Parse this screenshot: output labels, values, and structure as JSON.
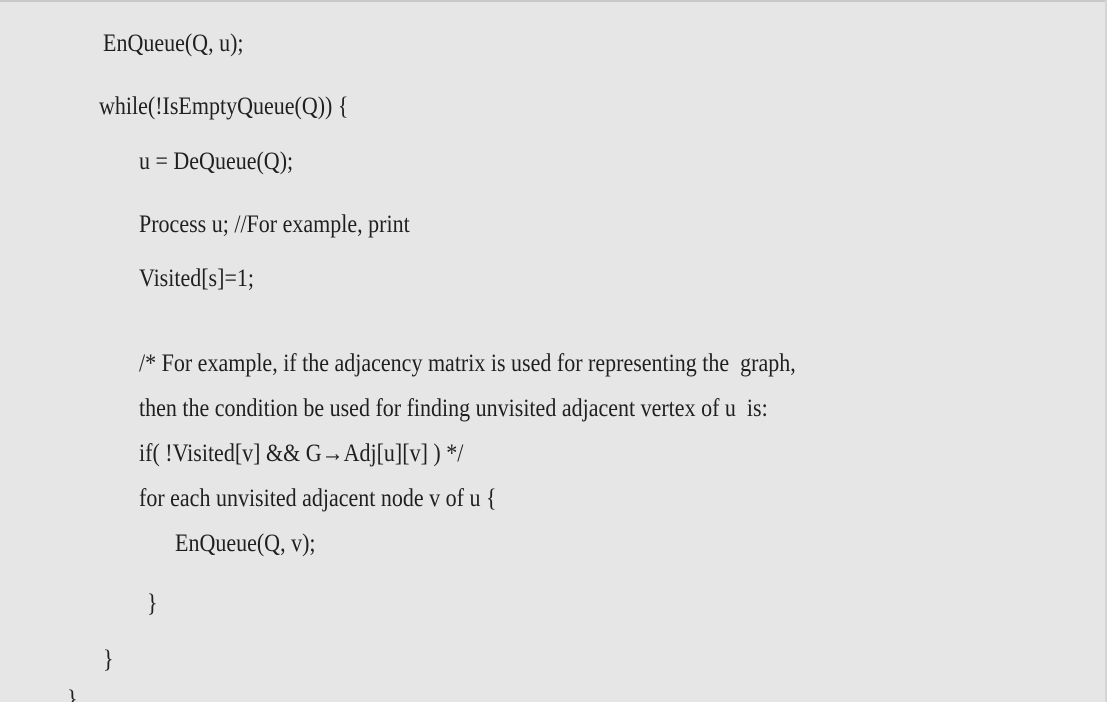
{
  "code": {
    "lines": [
      "EnQueue(Q, u);",
      "while(!IsEmptyQueue(Q)) {",
      "u = DeQueue(Q);",
      "Process u; //For example, print",
      "Visited[s]=1;",
      "/* For example, if the adjacency matrix is used for representing the  graph,",
      "then the condition be used for finding unvisited adjacent vertex of u  is:",
      "if( !Visited[v] && G→Adj[u][v] ) */",
      "for each unvisited adjacent node v of u {",
      "EnQueue(Q, v);",
      "}",
      "}",
      "}"
    ]
  }
}
